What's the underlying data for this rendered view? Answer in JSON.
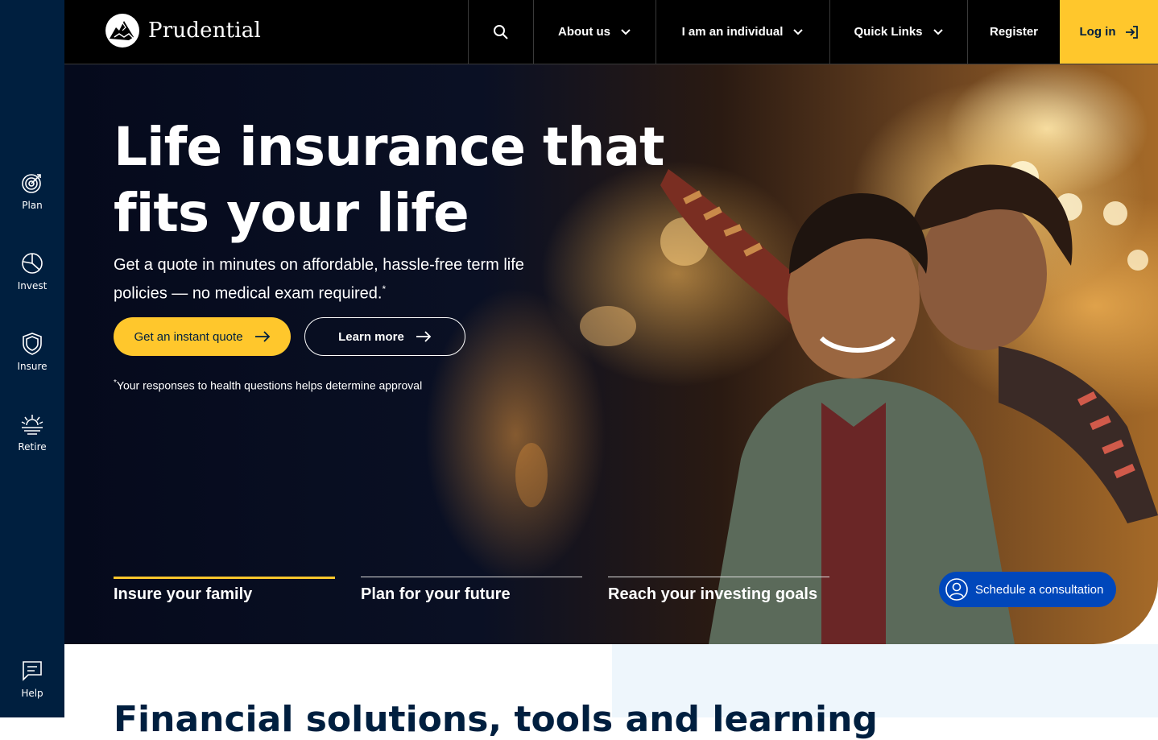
{
  "brand": {
    "name": "Prudential",
    "accent": "#ffc72c",
    "navy": "#001f3f",
    "blue": "#0047bb"
  },
  "rail": {
    "items": [
      {
        "label": "Plan",
        "icon": "target-icon"
      },
      {
        "label": "Invest",
        "icon": "pie-chart-icon"
      },
      {
        "label": "Insure",
        "icon": "shield-icon"
      },
      {
        "label": "Retire",
        "icon": "sunrise-icon"
      },
      {
        "label": "Help",
        "icon": "chat-icon"
      }
    ]
  },
  "nav": {
    "about": "About us",
    "individual": "I am an individual",
    "quick_links": "Quick Links",
    "register": "Register",
    "login": "Log in"
  },
  "hero": {
    "title": "Life insurance that fits your life",
    "subtitle": "Get a quote in minutes on affordable, hassle-free term life policies — no medical exam required.",
    "subtitle_mark": "*",
    "cta_primary": "Get an instant quote",
    "cta_secondary": "Learn more",
    "footnote_mark": "*",
    "footnote": "Your responses to health questions helps determine approval"
  },
  "tabs": [
    {
      "label": "Insure your family",
      "active": true
    },
    {
      "label": "Plan for your future",
      "active": false
    },
    {
      "label": "Reach your investing goals",
      "active": false
    }
  ],
  "consultation": {
    "label": "Schedule a consultation"
  },
  "section": {
    "heading_bold": "Financial solutions",
    "heading_rest": ", tools and learning"
  }
}
